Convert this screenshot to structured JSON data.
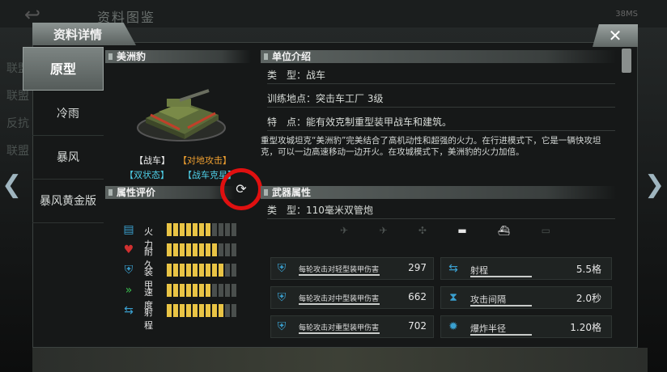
{
  "background": {
    "title": "资料图鉴",
    "status": "38MS",
    "side_items": [
      "联盟",
      "联盟",
      "反抗",
      "联盟"
    ]
  },
  "dialog": {
    "title": "资料详情",
    "close_label": "✕"
  },
  "tabs": [
    {
      "label": "原型",
      "active": true
    },
    {
      "label": "冷雨",
      "active": false
    },
    {
      "label": "暴风",
      "active": false
    },
    {
      "label": "暴风黄金版",
      "active": false
    }
  ],
  "unit": {
    "name": "美洲豹",
    "tags": [
      {
        "text": "【战车】",
        "color": "#f0f0f0"
      },
      {
        "text": "【对地攻击】",
        "color": "#f0a030"
      },
      {
        "text": "【双状态】",
        "color": "#4fd0e8"
      },
      {
        "text": "【战车克星】",
        "color": "#4fd0e8"
      }
    ]
  },
  "rating": {
    "header": "属性评价",
    "stats": [
      {
        "label": "火力",
        "value": 7,
        "max": 11,
        "icon": "firepower-icon",
        "glyph": "▤",
        "color": "#3aa0d0"
      },
      {
        "label": "耐久",
        "value": 8,
        "max": 11,
        "icon": "heart-icon",
        "glyph": "♥",
        "color": "#d03030"
      },
      {
        "label": "装甲",
        "value": 9,
        "max": 11,
        "icon": "armor-icon",
        "glyph": "⛨",
        "color": "#3aa0d0"
      },
      {
        "label": "速度",
        "value": 7,
        "max": 11,
        "icon": "speed-icon",
        "glyph": "»",
        "color": "#3ac050"
      },
      {
        "label": "射程",
        "value": 9,
        "max": 11,
        "icon": "range-icon",
        "glyph": "⇆",
        "color": "#3aa0d0"
      }
    ]
  },
  "intro": {
    "header": "单位介绍",
    "type_label": "类　型：",
    "type_value": "战车",
    "train_label": "训练地点：",
    "train_value": "突击车工厂 3级",
    "feature_label": "特　点：",
    "feature_value": "能有效克制重型装甲战车和建筑。",
    "description": "重型攻城坦克“美洲豹”完美结合了高机动性和超强的火力。在行进模式下，它是一辆快攻坦克，可以一边高速移动一边开火。在攻城模式下，美洲豹的火力加倍。"
  },
  "weapon": {
    "header": "武器属性",
    "type_label": "类　型：",
    "type_value": "110毫米双管炮",
    "targets": [
      {
        "icon": "aircraft-icon",
        "glyph": "✈",
        "on": false
      },
      {
        "icon": "jet-icon",
        "glyph": "✈",
        "on": false
      },
      {
        "icon": "helicopter-icon",
        "glyph": "✣",
        "on": false
      },
      {
        "icon": "tank-target-icon",
        "glyph": "▬",
        "on": true
      },
      {
        "icon": "ship-icon",
        "glyph": "⛴",
        "on": true
      },
      {
        "icon": "submarine-icon",
        "glyph": "▭",
        "on": false
      }
    ],
    "damage": [
      {
        "label": "每轮攻击对轻型装甲伤害",
        "value": "297"
      },
      {
        "label": "每轮攻击对中型装甲伤害",
        "value": "662"
      },
      {
        "label": "每轮攻击对重型装甲伤害",
        "value": "702"
      }
    ],
    "props": [
      {
        "label": "射程",
        "value": "5.5格",
        "icon": "range-icon",
        "glyph": "⇆"
      },
      {
        "label": "攻击间隔",
        "value": "2.0秒",
        "icon": "hourglass-icon",
        "glyph": "⧗"
      },
      {
        "label": "爆炸半径",
        "value": "1.20格",
        "icon": "explosion-icon",
        "glyph": "✹"
      }
    ]
  }
}
